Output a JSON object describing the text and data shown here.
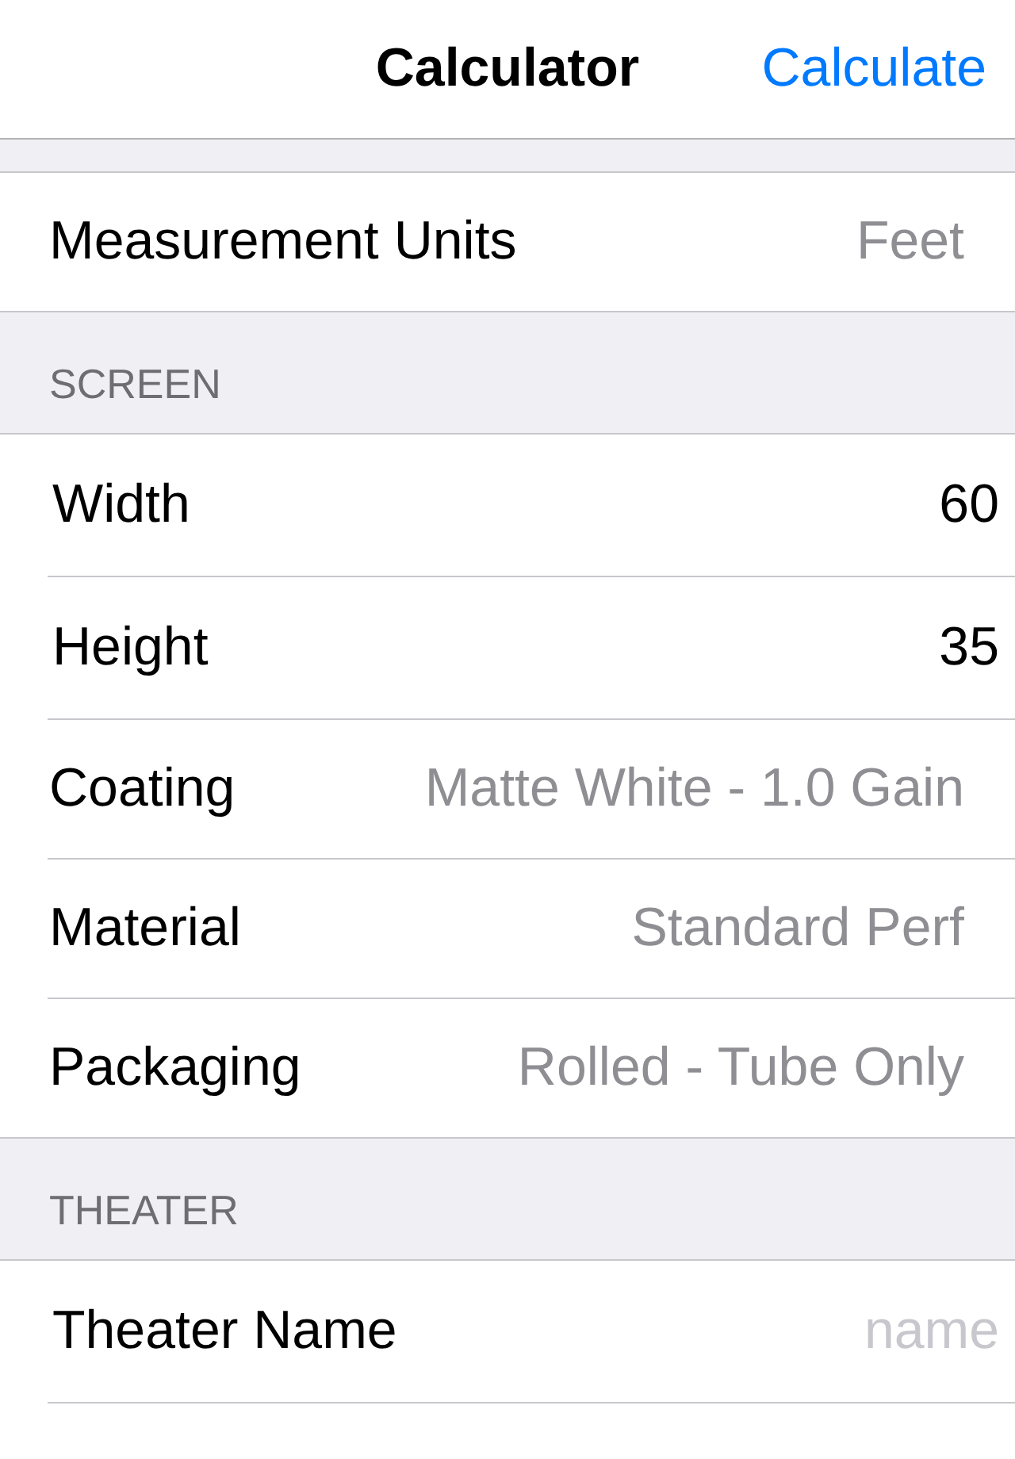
{
  "navigation_bar": {
    "title": "Calculator",
    "action": "Calculate"
  },
  "sections": [
    {
      "rows": [
        {
          "kind": "picker",
          "label": "Measurement Units",
          "value": "Feet"
        }
      ]
    },
    {
      "header": "SCREEN",
      "rows": [
        {
          "kind": "input",
          "label": "Width",
          "value": "60"
        },
        {
          "kind": "input",
          "label": "Height",
          "value": "35"
        },
        {
          "kind": "picker",
          "label": "Coating",
          "value": "Matte White - 1.0 Gain"
        },
        {
          "kind": "picker",
          "label": "Material",
          "value": "Standard Perf"
        },
        {
          "kind": "picker",
          "label": "Packaging",
          "value": "Rolled - Tube Only"
        }
      ]
    },
    {
      "header": "THEATER",
      "rows": [
        {
          "kind": "input",
          "label": "Theater Name",
          "placeholder": "name"
        }
      ]
    }
  ]
}
